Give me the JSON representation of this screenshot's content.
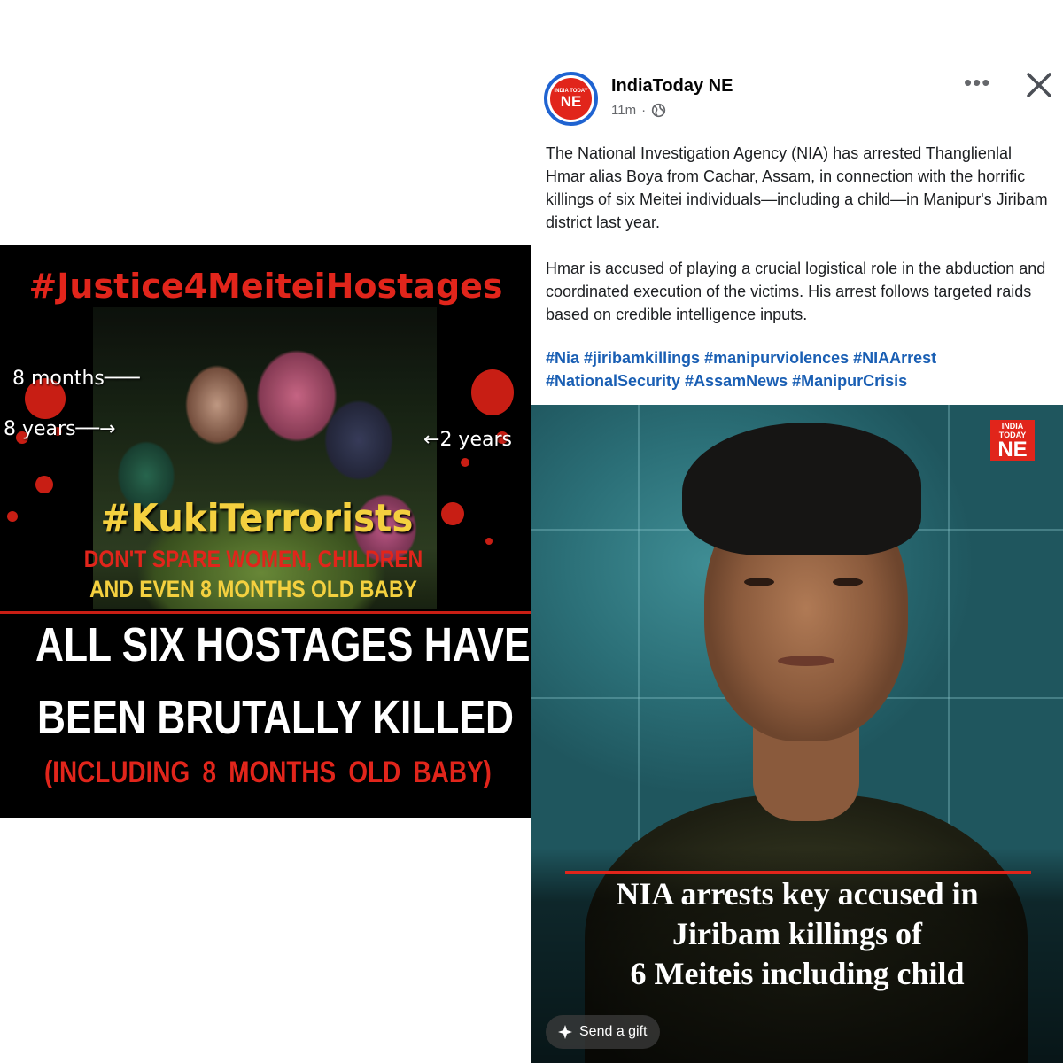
{
  "poster": {
    "hashtag_top": "#Justice4MeiteiHostages",
    "labels": {
      "eight_months": "8 months",
      "eight_years": "8 years",
      "two_years": "2 years"
    },
    "hashtag_mid": "#KukiTerrorists",
    "subline_1": "DON'T SPARE WOMEN, CHILDREN",
    "subline_2": "AND EVEN 8 MONTHS OLD BABY",
    "big_line_1": "ALL SIX HOSTAGES HAVE",
    "big_line_2": "BEEN BRUTALLY KILLED",
    "including_line": "(INCLUDING 8 MONTHS OLD BABY)"
  },
  "post": {
    "avatar": {
      "small_text": "INDIA TODAY",
      "big_text": "NE"
    },
    "page_name": "IndiaToday NE",
    "time": "11m",
    "separator": "·",
    "privacy_icon": "globe-icon",
    "more_icon": "more-options-icon",
    "close_icon": "close-icon",
    "paragraph_1": "The National Investigation Agency (NIA) has arrested Thanglienlal Hmar alias Boya from Cachar, Assam, in connection with the horrific killings of six Meitei individuals—including a child—in Manipur's Jiribam district last year.",
    "paragraph_2": "Hmar is accused of playing a crucial logistical role in the abduction and coordinated execution of the victims. His arrest follows targeted raids based on credible intelligence inputs.",
    "hashtags": "#Nia #jiribamkillings #manipurviolences #NIAArrest #NationalSecurity #AssamNews #ManipurCrisis",
    "image": {
      "brand_small": "INDIA TODAY",
      "brand_big": "NE",
      "headline_1": "NIA arrests key accused in",
      "headline_2": "Jiribam killings of",
      "headline_3": "6 Meiteis including child"
    },
    "gift_button": "Send a gift"
  },
  "colors": {
    "brand_red": "#e1251b",
    "poster_yellow": "#f4d03f",
    "link_blue": "#1a5fb4",
    "avatar_ring": "#1f63d1"
  }
}
